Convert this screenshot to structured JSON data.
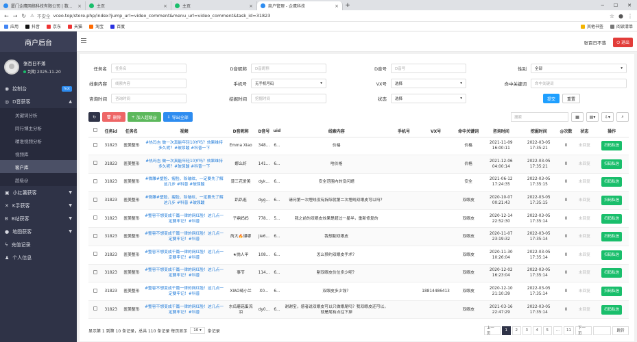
{
  "browser": {
    "tabs": [
      {
        "title": "厦门企鹰网络科技有限公司 | 数..."
      },
      {
        "title": "主页"
      },
      {
        "title": "主页"
      },
      {
        "title": "商户管理 - 企鹰科技"
      }
    ],
    "new_tab": "+",
    "url_secure_label": "不安全",
    "url": "vceo.top/store.php/index?jump_url=video_comment&menu_url=video_comment&task_id=31823",
    "bookmarks": [
      "应用",
      "抖音",
      "京东",
      "天猫",
      "淘宝",
      "百度"
    ],
    "bookmarks_right": [
      "其他书签",
      "阅读清单"
    ]
  },
  "sidebar": {
    "brand": "商户后台",
    "user_name": "张百日不落",
    "user_status": "到期 2025-11-20",
    "menu": [
      {
        "label": "控制台",
        "badge": "hot"
      },
      {
        "label": "D音获客",
        "expanded": true
      },
      {
        "label": "小红薯获客"
      },
      {
        "label": "K手获客"
      },
      {
        "label": "B站获客"
      },
      {
        "label": "地图获客"
      },
      {
        "label": "充值记录"
      },
      {
        "label": "个人信息"
      }
    ],
    "submenu": [
      "关键词分析",
      "同行博主分析",
      "精准视频分析",
      "视频库",
      "客户库",
      "超级@"
    ]
  },
  "header": {
    "user": "张百日不落",
    "logout": "退出"
  },
  "filters": {
    "row1": [
      {
        "label": "任务名",
        "placeholder": "任务名"
      },
      {
        "label": "D音昵称",
        "placeholder": "D音昵称"
      },
      {
        "label": "D音号",
        "placeholder": "D音号"
      },
      {
        "label": "性别",
        "value": "全部"
      }
    ],
    "row2": [
      {
        "label": "线索内容",
        "placeholder": "线索内容"
      },
      {
        "label": "手机号",
        "value": "无手机号码"
      },
      {
        "label": "VX号",
        "value": "选择"
      },
      {
        "label": "命中关键词",
        "placeholder": "命中关键词"
      }
    ],
    "row3": [
      {
        "label": "咨询时间",
        "placeholder": "咨询时间"
      },
      {
        "label": "挖掘时间",
        "placeholder": "挖掘时间"
      },
      {
        "label": "状态",
        "value": "选择"
      }
    ],
    "submit": "提交",
    "reset": "重置"
  },
  "toolbar": {
    "delete": "删除",
    "add_super": "加入超级@",
    "export": "导出全部",
    "search_placeholder": "搜索"
  },
  "table": {
    "headers": [
      "任务id",
      "任务名",
      "视频",
      "D音昵称",
      "D音号",
      "uid",
      "线索内容",
      "手机号",
      "VX号",
      "命中关键词",
      "咨询时间",
      "挖掘时间",
      "@次数",
      "状态",
      "操作"
    ],
    "rows": [
      {
        "id": "31823",
        "task": "医美整形",
        "video": "#热玛吉 做一次真能年轻10岁吗？效果维持多久呢？#玻尿酸 #科普一下",
        "nick": "Emma Xiao",
        "dy": "348...",
        "uid": "6...",
        "content": "价格",
        "phone": "",
        "vx": "",
        "kw": "价格",
        "ask": "2021-11-09 16:00:11",
        "mine": "2022-03-05 17:35:21",
        "at": "0",
        "status": "未回复",
        "op": "扫码私信"
      },
      {
        "id": "31823",
        "task": "医美整形",
        "video": "#热玛吉 做一次真能年轻10岁吗？效果维持多久呢？#玻尿酸 #科普一下",
        "nick": "娜么好",
        "dy": "141...",
        "uid": "6...",
        "content": "啥价格",
        "phone": "",
        "vx": "",
        "kw": "价格",
        "ask": "2021-12-06 04:00:14",
        "mine": "2022-03-05 17:35:21",
        "at": "0",
        "status": "未回复",
        "op": "扫码私信"
      },
      {
        "id": "31823",
        "task": "医美整形",
        "video": "#微雕#塑脸、瘦脸、除皱纹、一定要先了解这几步 #科普 #玻尿酸",
        "nick": "蒜三花爱美",
        "dy": "dyk...",
        "uid": "6...",
        "content": "安全范围内的没问题",
        "phone": "",
        "vx": "",
        "kw": "安全",
        "ask": "2021-06-12 17:24:35",
        "mine": "2022-03-05 17:35:15",
        "at": "0",
        "status": "未回复",
        "op": "扫码私信"
      },
      {
        "id": "31823",
        "task": "医美整形",
        "video": "#微雕#塑脸、瘦脸、除皱纹、一定要先了解这几步 #科普 #玻尿酸",
        "nick": "趴趴逛",
        "dyk": "",
        "dy": "dyg...",
        "uid": "6...",
        "content": "请问第一次埋线没有拆除就第二次埋线双眼皮可以吗？",
        "phone": "",
        "vx": "",
        "kw": "双眼皮",
        "ask": "2020-10-07 00:21:43",
        "mine": "2022-03-05 17:35:15",
        "at": "0",
        "status": "未回复",
        "op": "扫码私信"
      },
      {
        "id": "31823",
        "task": "医美整形",
        "video": "#整容不想变成千篇一律的网红脸！这几点一定要牢记！#科普",
        "nick": "子鼎妈妈",
        "dy": "778...",
        "uid": "5...",
        "content": "我之前的双眼皮效果是超过一星半，重新修复的",
        "phone": "",
        "vx": "",
        "kw": "双眼皮",
        "ask": "2020-12-14 22:52:30",
        "mine": "2022-03-05 17:35:14",
        "at": "0",
        "status": "未回复",
        "op": "扫码私信"
      },
      {
        "id": "31823",
        "task": "医美整形",
        "video": "#整容不想变成千篇一律的网红脸！这几点一定要牢记！#科普",
        "nick": "芮大🔥爆哪",
        "dy": "jie6...",
        "uid": "6...",
        "content": "我想割双眼皮",
        "phone": "",
        "vx": "",
        "kw": "双眼皮",
        "ask": "2020-11-07 23:19:32",
        "mine": "2022-03-05 17:35:14",
        "at": "0",
        "status": "未回复",
        "op": "扫码私信"
      },
      {
        "id": "31823",
        "task": "医美整形",
        "video": "#整容不想变成千篇一律的网红脸！这几点一定要牢记！#科普",
        "nick": "★抛人甲",
        "dy": "108...",
        "uid": "6...",
        "content": "怎么预约双眼皮手术？",
        "phone": "",
        "vx": "",
        "kw": "双眼皮",
        "ask": "2020-11-30 10:26:04",
        "mine": "2022-03-05 17:35:14",
        "at": "0",
        "status": "未回复",
        "op": "扫码私信"
      },
      {
        "id": "31823",
        "task": "医美整形",
        "video": "#整容不想变成千篇一律的网红脸！这几点一定要牢记！#科普",
        "nick": "事节",
        "dy": "114...",
        "uid": "6...",
        "content": "割双眼皮价位多少呢？",
        "phone": "",
        "vx": "",
        "kw": "双眼皮",
        "ask": "2020-12-02 16:23:04",
        "mine": "2022-03-05 17:35:14",
        "at": "0",
        "status": "未回复",
        "op": "扫码私信"
      },
      {
        "id": "31823",
        "task": "医美整形",
        "video": "#整容不想变成千篇一律的网红脸！这几点一定要牢记！#科普",
        "nick": "XIAO绮小兰",
        "dy": "X0...",
        "uid": "6...",
        "content": "双眼皮多少钱？",
        "phone": "",
        "vx": "18814486413",
        "kw": "双眼皮",
        "ask": "2020-12-10 21:10:39",
        "mine": "2022-03-05 17:35:14",
        "at": "0",
        "status": "未回复",
        "op": "扫码私信"
      },
      {
        "id": "31823",
        "task": "医美整形",
        "video": "#整容不想变成千篇一律的网红脸！这几点一定要牢记！#科普",
        "nick": "东瓜蘑菇蛋流泪",
        "dy": "dy0...",
        "uid": "6...",
        "content": "谢谢宝，感者说双眼皮可以只做眼尾吗？我双眼皮还可以，就是尾有点往下掉",
        "phone": "",
        "vx": "",
        "kw": "双眼皮",
        "ask": "2021-03-16 22:47:29",
        "mine": "2022-03-05 17:35:14",
        "at": "0",
        "status": "未回复",
        "op": "扫码私信"
      }
    ]
  },
  "footer": {
    "info_prefix": "显示第 1 到第 10 条记录，总共 110 条记录 每页显示",
    "page_size": "10",
    "info_suffix": "条记录",
    "prev": "上一页",
    "pages": [
      "1",
      "2",
      "3",
      "4",
      "5",
      "...",
      "11"
    ],
    "next": "下一页",
    "jump": "跳转"
  }
}
